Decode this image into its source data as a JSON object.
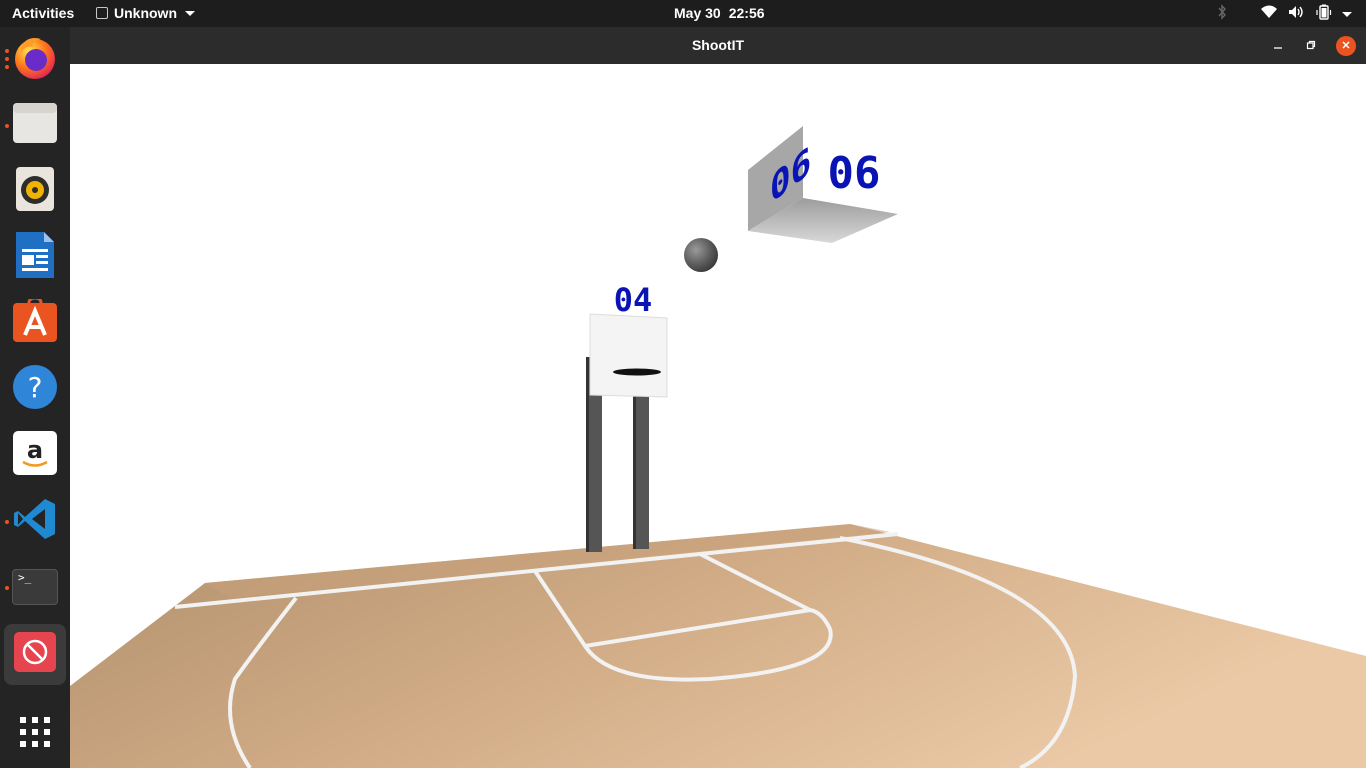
{
  "topbar": {
    "activities": "Activities",
    "app_name": "Unknown",
    "date": "May 30",
    "time": "22:56"
  },
  "dock": {
    "items": [
      {
        "name": "firefox",
        "icon": "firefox-icon",
        "running": true
      },
      {
        "name": "files",
        "icon": "folder-icon",
        "running": true
      },
      {
        "name": "rhythmbox",
        "icon": "speaker-icon",
        "running": false
      },
      {
        "name": "libreoffice-writer",
        "icon": "document-icon",
        "running": false
      },
      {
        "name": "ubuntu-software",
        "icon": "software-store-icon",
        "running": false
      },
      {
        "name": "help",
        "icon": "help-icon",
        "running": false
      },
      {
        "name": "amazon",
        "icon": "amazon-icon",
        "running": false
      },
      {
        "name": "vscode",
        "icon": "vscode-icon",
        "running": true
      },
      {
        "name": "terminal",
        "icon": "terminal-icon",
        "running": true
      },
      {
        "name": "shootit",
        "icon": "no-entry-icon",
        "running": true,
        "active": true
      },
      {
        "name": "show-apps",
        "icon": "app-grid-icon",
        "running": false
      }
    ],
    "terminal_prompt": ">_"
  },
  "window": {
    "title": "ShootIT"
  },
  "game": {
    "hoop_score": "04",
    "scoreboard_front": "06",
    "scoreboard_side": "06",
    "colors": {
      "digits": "#0a14b4",
      "court": "#d2aa82",
      "lines": "#f2f2f2"
    }
  }
}
